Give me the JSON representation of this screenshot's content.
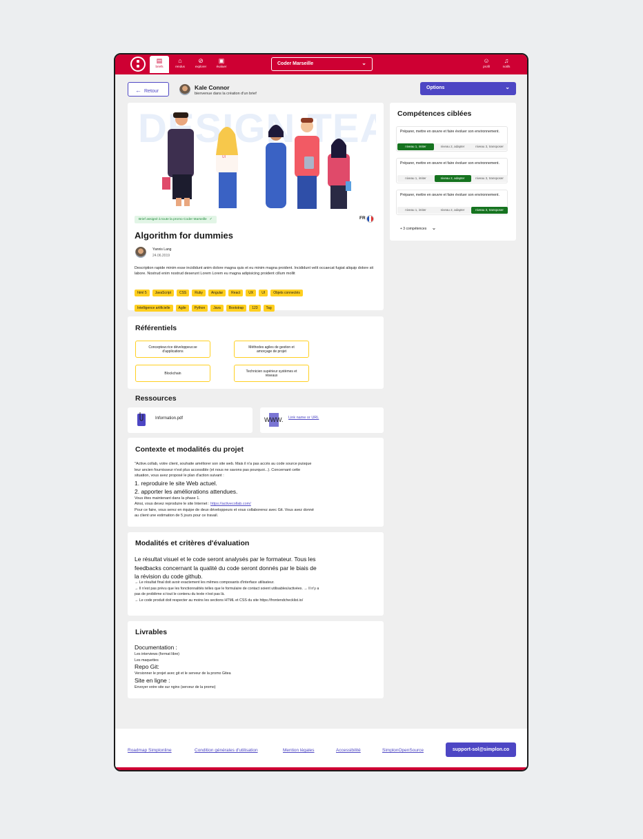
{
  "nav": {
    "items": [
      {
        "label": "briefs",
        "icon": "clipboard-icon"
      },
      {
        "label": "rendus",
        "icon": "inbox-icon"
      },
      {
        "label": "explorer",
        "icon": "compass-icon"
      },
      {
        "label": "évaluer",
        "icon": "grid-icon"
      }
    ],
    "city": "Coder Marseille",
    "profil": "profil",
    "notifs": "notifs"
  },
  "header": {
    "back_label": "Retour",
    "user_name": "Kale Connor",
    "user_sub": "bienvenue dans la création d'un brief",
    "options_label": "Options"
  },
  "brief": {
    "hero_text": "DESIGN TEAM",
    "assigned": "Brief assigné à toute la promo Coder Marseille",
    "lang": "FR",
    "title": "Algorithm for dummies",
    "author": "Yannis Lang",
    "date": "24.06.2019",
    "description": "Description rapide minim esse incididunt anim dolore magna quis et eu minim magna proident. Incididunt velit occaecat fugiat aliquip dolore sit labore. Nostrud enim nostrud deserunt Lorem Lorem eu magna adipisicing proident cillum mollit",
    "tags_row1": [
      "html 5",
      "JavaScript",
      "CSS",
      "Ruby",
      "Angular",
      "React",
      "UX",
      "UI",
      "Objets connectés"
    ],
    "tags_row2": [
      "Intelligence artificielle",
      "Agile",
      "Python",
      "Java",
      "Bootstrap",
      "123",
      "Tag"
    ]
  },
  "referentiels": {
    "title": "Référentiels",
    "items": [
      "Concepteur.rice développeur.se d'applications",
      "Méthodes agiles de gestion et amorçage de projet",
      "Blockchain",
      "Technicien supérieur systèmes et réseaux"
    ]
  },
  "ressources": {
    "title": "Ressources",
    "file": "Information.pdf",
    "www": "WWW.",
    "link": "Link name or URL"
  },
  "contexte": {
    "title": "Contexte et modalités du projet",
    "p1": "\"Active.collab, votre client, souhaite améliorer son site web. Mais il n'a pas accès au code source puisque leur ancien fournisseur n'est plus accessible (et nous ne savons pas pourquoi...). Concernant cette situation, vous avez proposé le plan d'action suivant :",
    "step1": "1. reproduire le site Web actuel.",
    "step2": "2. apporter les améliorations attendues.",
    "p2": "Vous êtes maintenant dans la phase 1.",
    "p3": "Ainsi, vous devez reproduire le site Internet : ",
    "url": "https://activecollab.com/",
    "p4": "Pour ce faire, vous serez en équipe de deux développeurs et vous collaborerez avec Git. Vous avez donné au client une estimation de 5 jours pour ce travail."
  },
  "evaluation": {
    "title": "Modalités et critères d'évaluation",
    "big": "Le résultat visuel et le code seront analysés par le formateur. Tous les feedbacks concernant la qualité du code seront donnés par le biais de la révision du code github.",
    "l1": "→ Le résultat final doit avoir exactement les mêmes composants d'interface utilisateur.",
    "l2": "→ Il n'est pas prévu que les fonctionnalités telles que le formulaire de contact soient utilisables/activées. → Il n'y a pas de problème si tout le contenu du texte n'est pas là.",
    "l3": "→ Le code produit doit respecter au moins les sections HTML et CSS du site https://frontendchecklist.io/"
  },
  "livrables": {
    "title": "Livrables",
    "doc_h": "Documentation :",
    "doc_1": "Les interviews (format libre)",
    "doc_2": "Les maquettes",
    "git_h": "Repo Git:",
    "git_1": "Versionner le projet avec git et le serveur de la promo Gitea",
    "site_h": "Site en ligne :",
    "site_1": "Envoyer votre site sur nginx (serveur de la promo)"
  },
  "competences": {
    "title": "Compétences ciblées",
    "items": [
      {
        "text": "Préparer, mettre en œuvre et faire évoluer son environnement.",
        "active": 1
      },
      {
        "text": "Préparer, mettre en œuvre et faire évoluer son environnement.",
        "active": 2
      },
      {
        "text": "Préparer, mettre en œuvre et faire évoluer son environnement.",
        "active": 3
      }
    ],
    "levels": [
      "niveau 1, imiter",
      "niveau 2, adapter",
      "niveau 3, transposer"
    ],
    "more": "+ 3 compétences"
  },
  "footer": {
    "links": [
      "Roadmap Simplonline",
      "Condition générales d'utilisation",
      "Mention légales",
      "Accessibilité",
      "SimplonOpenSource"
    ],
    "support": "support-sol@simplon.co"
  },
  "colors": {
    "brand": "#ce0033",
    "accent": "#4d46c4",
    "tag": "#ffcf1f",
    "level_on": "#15731f"
  }
}
